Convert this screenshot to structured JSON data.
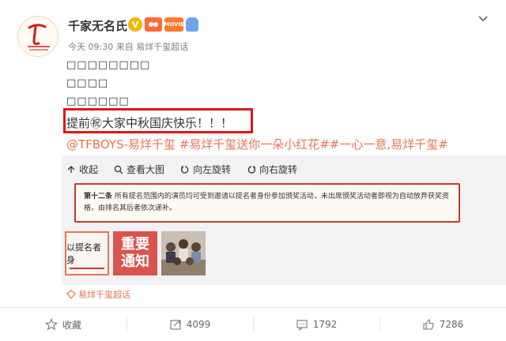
{
  "post": {
    "username": "千家无名氏",
    "badges": {
      "verified": "V",
      "movie": "MOVIE"
    },
    "meta": {
      "time": "今天 09:30",
      "from_label": "来自",
      "source": "易烊千玺超话"
    },
    "garbled_lines": [
      "□□□□□□□□",
      "□□□□",
      "□□□□□□"
    ],
    "main_text": "提前㊗大家中秋国庆快乐！！！",
    "tags": "@TFBOYS-易烊千玺 #易烊千玺送你一朵小红花##一心一意,易烊千玺#"
  },
  "toolbar": {
    "collapse": "收起",
    "view_large": "查看大图",
    "rotate_left": "向左旋转",
    "rotate_right": "向右旋转"
  },
  "notice": {
    "heading": "第十二条",
    "body": "所有提名范围内的演员均可受到邀请以提名者身份参加颁奖活动，未出席颁奖活动者即视为自动放弃获奖资格，由排名其后者依次递补。"
  },
  "thumbnails": {
    "thumb1_text": "以提名者身",
    "thumb2_line1": "重要",
    "thumb2_line2": "通知"
  },
  "topic_link": "易烊千玺超话",
  "footer": {
    "favorite": "收藏",
    "repost": "4099",
    "comment": "1792",
    "like": "7286"
  },
  "colors": {
    "link": "#eb7350",
    "highlight_border": "#e3141a",
    "notice_border": "#c23a2a"
  }
}
